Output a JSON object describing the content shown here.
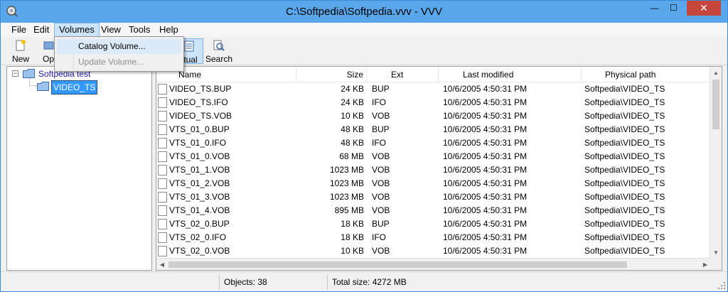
{
  "window": {
    "title": "C:\\Softpedia\\Softpedia.vvv - VVV",
    "minimize_glyph": "—",
    "maximize_glyph": "☐",
    "close_glyph": "✕"
  },
  "menubar": {
    "items": [
      "File",
      "Edit",
      "Volumes",
      "View",
      "Tools",
      "Help"
    ],
    "active": "Volumes"
  },
  "toolbar": {
    "new_label": "New",
    "open_label": "Op",
    "virtual_label": "rtual",
    "search_label": "Search"
  },
  "volumes_menu": {
    "items": [
      {
        "label": "Catalog Volume...",
        "enabled": true
      },
      {
        "label": "Update Volume...",
        "enabled": false
      }
    ]
  },
  "tree": {
    "root_label": "Softpedia test",
    "child_label": "VIDEO_TS",
    "expander_glyph": "−"
  },
  "list": {
    "columns": [
      "Name",
      "Size",
      "Ext",
      "Last modified",
      "Physical path"
    ],
    "rows": [
      {
        "name": "VIDEO_TS.BUP",
        "size": "24 KB",
        "ext": "BUP",
        "modified": "10/6/2005 4:50:31 PM",
        "path": "Softpedia\\VIDEO_TS"
      },
      {
        "name": "VIDEO_TS.IFO",
        "size": "24 KB",
        "ext": "IFO",
        "modified": "10/6/2005 4:50:31 PM",
        "path": "Softpedia\\VIDEO_TS"
      },
      {
        "name": "VIDEO_TS.VOB",
        "size": "10 KB",
        "ext": "VOB",
        "modified": "10/6/2005 4:50:31 PM",
        "path": "Softpedia\\VIDEO_TS"
      },
      {
        "name": "VTS_01_0.BUP",
        "size": "48 KB",
        "ext": "BUP",
        "modified": "10/6/2005 4:50:31 PM",
        "path": "Softpedia\\VIDEO_TS"
      },
      {
        "name": "VTS_01_0.IFO",
        "size": "48 KB",
        "ext": "IFO",
        "modified": "10/6/2005 4:50:31 PM",
        "path": "Softpedia\\VIDEO_TS"
      },
      {
        "name": "VTS_01_0.VOB",
        "size": "68 MB",
        "ext": "VOB",
        "modified": "10/6/2005 4:50:31 PM",
        "path": "Softpedia\\VIDEO_TS"
      },
      {
        "name": "VTS_01_1.VOB",
        "size": "1023 MB",
        "ext": "VOB",
        "modified": "10/6/2005 4:50:31 PM",
        "path": "Softpedia\\VIDEO_TS"
      },
      {
        "name": "VTS_01_2.VOB",
        "size": "1023 MB",
        "ext": "VOB",
        "modified": "10/6/2005 4:50:31 PM",
        "path": "Softpedia\\VIDEO_TS"
      },
      {
        "name": "VTS_01_3.VOB",
        "size": "1023 MB",
        "ext": "VOB",
        "modified": "10/6/2005 4:50:31 PM",
        "path": "Softpedia\\VIDEO_TS"
      },
      {
        "name": "VTS_01_4.VOB",
        "size": "895 MB",
        "ext": "VOB",
        "modified": "10/6/2005 4:50:31 PM",
        "path": "Softpedia\\VIDEO_TS"
      },
      {
        "name": "VTS_02_0.BUP",
        "size": "18 KB",
        "ext": "BUP",
        "modified": "10/6/2005 4:50:31 PM",
        "path": "Softpedia\\VIDEO_TS"
      },
      {
        "name": "VTS_02_0.IFO",
        "size": "18 KB",
        "ext": "IFO",
        "modified": "10/6/2005 4:50:31 PM",
        "path": "Softpedia\\VIDEO_TS"
      },
      {
        "name": "VTS_02_0.VOB",
        "size": "10 KB",
        "ext": "VOB",
        "modified": "10/6/2005 4:50:31 PM",
        "path": "Softpedia\\VIDEO_TS"
      }
    ]
  },
  "statusbar": {
    "objects": "Objects: 38",
    "total_size": "Total size: 4272 MB"
  },
  "scroll": {
    "up_glyph": "▲",
    "down_glyph": "▼",
    "left_glyph": "◀",
    "right_glyph": "▶"
  },
  "colors": {
    "titlebar": "#5aa6ea",
    "close_button": "#c7463c",
    "selection": "#3399ff",
    "menu_highlight": "#cce4f7"
  },
  "icons": {
    "app": "magnifier-disc-icon",
    "new": "new-catalog-icon",
    "open": "open-icon",
    "virtual": "virtual-view-icon",
    "search": "search-icon",
    "folder": "folder-icon",
    "file": "file-icon"
  }
}
